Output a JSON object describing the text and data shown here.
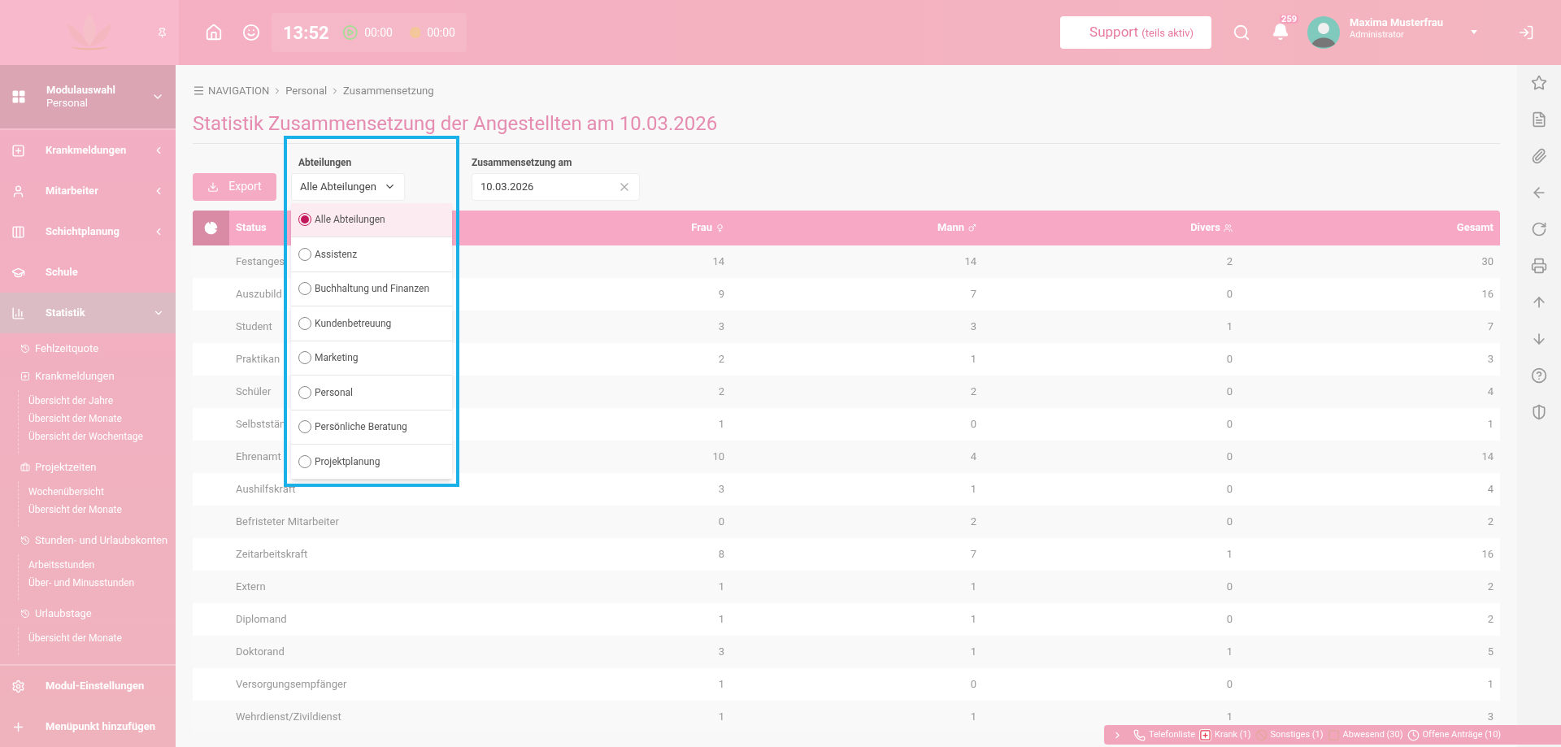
{
  "header": {
    "time": "13:52",
    "timer_work": "00:00",
    "timer_break": "00:00",
    "support": {
      "label": "Support",
      "note": "(teils aktiv)"
    },
    "notifications": "259",
    "user": {
      "name": "Maxima Musterfrau",
      "role": "Administrator"
    }
  },
  "sidebar": {
    "module": {
      "title": "Modulauswahl",
      "subtitle": "Personal"
    },
    "items": [
      {
        "label": "Krankmeldungen",
        "expanded": false,
        "selected": false,
        "has_children": true
      },
      {
        "label": "Mitarbeiter",
        "expanded": false,
        "selected": false,
        "has_children": true
      },
      {
        "label": "Schichtplanung",
        "expanded": false,
        "selected": false,
        "has_children": true
      },
      {
        "label": "Schule",
        "expanded": false,
        "selected": false,
        "has_children": false
      },
      {
        "label": "Statistik",
        "expanded": true,
        "selected": true,
        "has_children": true,
        "children": [
          {
            "label": "Fehlzeitquote"
          },
          {
            "label": "Krankmeldungen",
            "children": [
              {
                "label": "Übersicht der Jahre"
              },
              {
                "label": "Übersicht der Monate"
              },
              {
                "label": "Übersicht der Wochentage"
              }
            ]
          },
          {
            "label": "Projektzeiten",
            "children": [
              {
                "label": "Wochenübersicht"
              },
              {
                "label": "Übersicht der Monate"
              }
            ]
          },
          {
            "label": "Stunden- und Urlaubskonten",
            "children": [
              {
                "label": "Arbeitsstunden"
              },
              {
                "label": "Über- und Minusstunden"
              }
            ]
          },
          {
            "label": "Urlaubstage",
            "children": [
              {
                "label": "Übersicht der Monate"
              }
            ]
          }
        ]
      }
    ],
    "footer_items": [
      {
        "label": "Modul-Einstellungen"
      },
      {
        "label": "Menüpunkt hinzufügen"
      }
    ]
  },
  "breadcrumb": [
    "NAVIGATION",
    "Personal",
    "Zusammensetzung"
  ],
  "title": "Statistik Zusammensetzung der Angestellten am 10.03.2026",
  "export_button": "Export",
  "department_filter": {
    "label": "Abteilungen",
    "value": "Alle Abteilungen",
    "expanded": true,
    "options": [
      {
        "label": "Alle Abteilungen",
        "selected": true
      },
      {
        "label": "Assistenz",
        "selected": false
      },
      {
        "label": "Buchhaltung und Finanzen",
        "selected": false
      },
      {
        "label": "Kundenbetreuung",
        "selected": false
      },
      {
        "label": "Marketing",
        "selected": false
      },
      {
        "label": "Personal",
        "selected": false
      },
      {
        "label": "Persönliche Beratung",
        "selected": false
      },
      {
        "label": "Projektplanung",
        "selected": false
      }
    ]
  },
  "date_filter": {
    "label": "Zusammensetzung am",
    "value": "10.03.2026"
  },
  "table": {
    "columns": [
      "Status",
      "Frau",
      "Mann",
      "Divers",
      "Gesamt"
    ],
    "rows": [
      [
        "Festanges",
        "14",
        "14",
        "2",
        "30"
      ],
      [
        "Auszubild",
        "9",
        "7",
        "0",
        "16"
      ],
      [
        "Student",
        "3",
        "3",
        "1",
        "7"
      ],
      [
        "Praktikan",
        "2",
        "1",
        "0",
        "3"
      ],
      [
        "Schüler",
        "2",
        "2",
        "0",
        "4"
      ],
      [
        "Selbststän",
        "1",
        "0",
        "0",
        "1"
      ],
      [
        "Ehrenamt",
        "10",
        "4",
        "0",
        "14"
      ],
      [
        "Aushilfskraft",
        "3",
        "1",
        "0",
        "4"
      ],
      [
        "Befristeter Mitarbeiter",
        "0",
        "2",
        "0",
        "2"
      ],
      [
        "Zeitarbeitskraft",
        "8",
        "7",
        "1",
        "16"
      ],
      [
        "Extern",
        "1",
        "1",
        "0",
        "2"
      ],
      [
        "Diplomand",
        "1",
        "1",
        "0",
        "2"
      ],
      [
        "Doktorand",
        "3",
        "1",
        "1",
        "5"
      ],
      [
        "Versorgungsempfänger",
        "1",
        "0",
        "0",
        "1"
      ],
      [
        "Wehrdienst/Zivildienst",
        "1",
        "1",
        "1",
        "3"
      ]
    ]
  },
  "status_bar": {
    "items": [
      {
        "label": "Telefonliste"
      },
      {
        "label": "Krank (1)"
      },
      {
        "label": "Sonstiges (1)"
      },
      {
        "label": "Abwesend (30)"
      },
      {
        "label": "Offene Anträge (10)"
      }
    ]
  }
}
